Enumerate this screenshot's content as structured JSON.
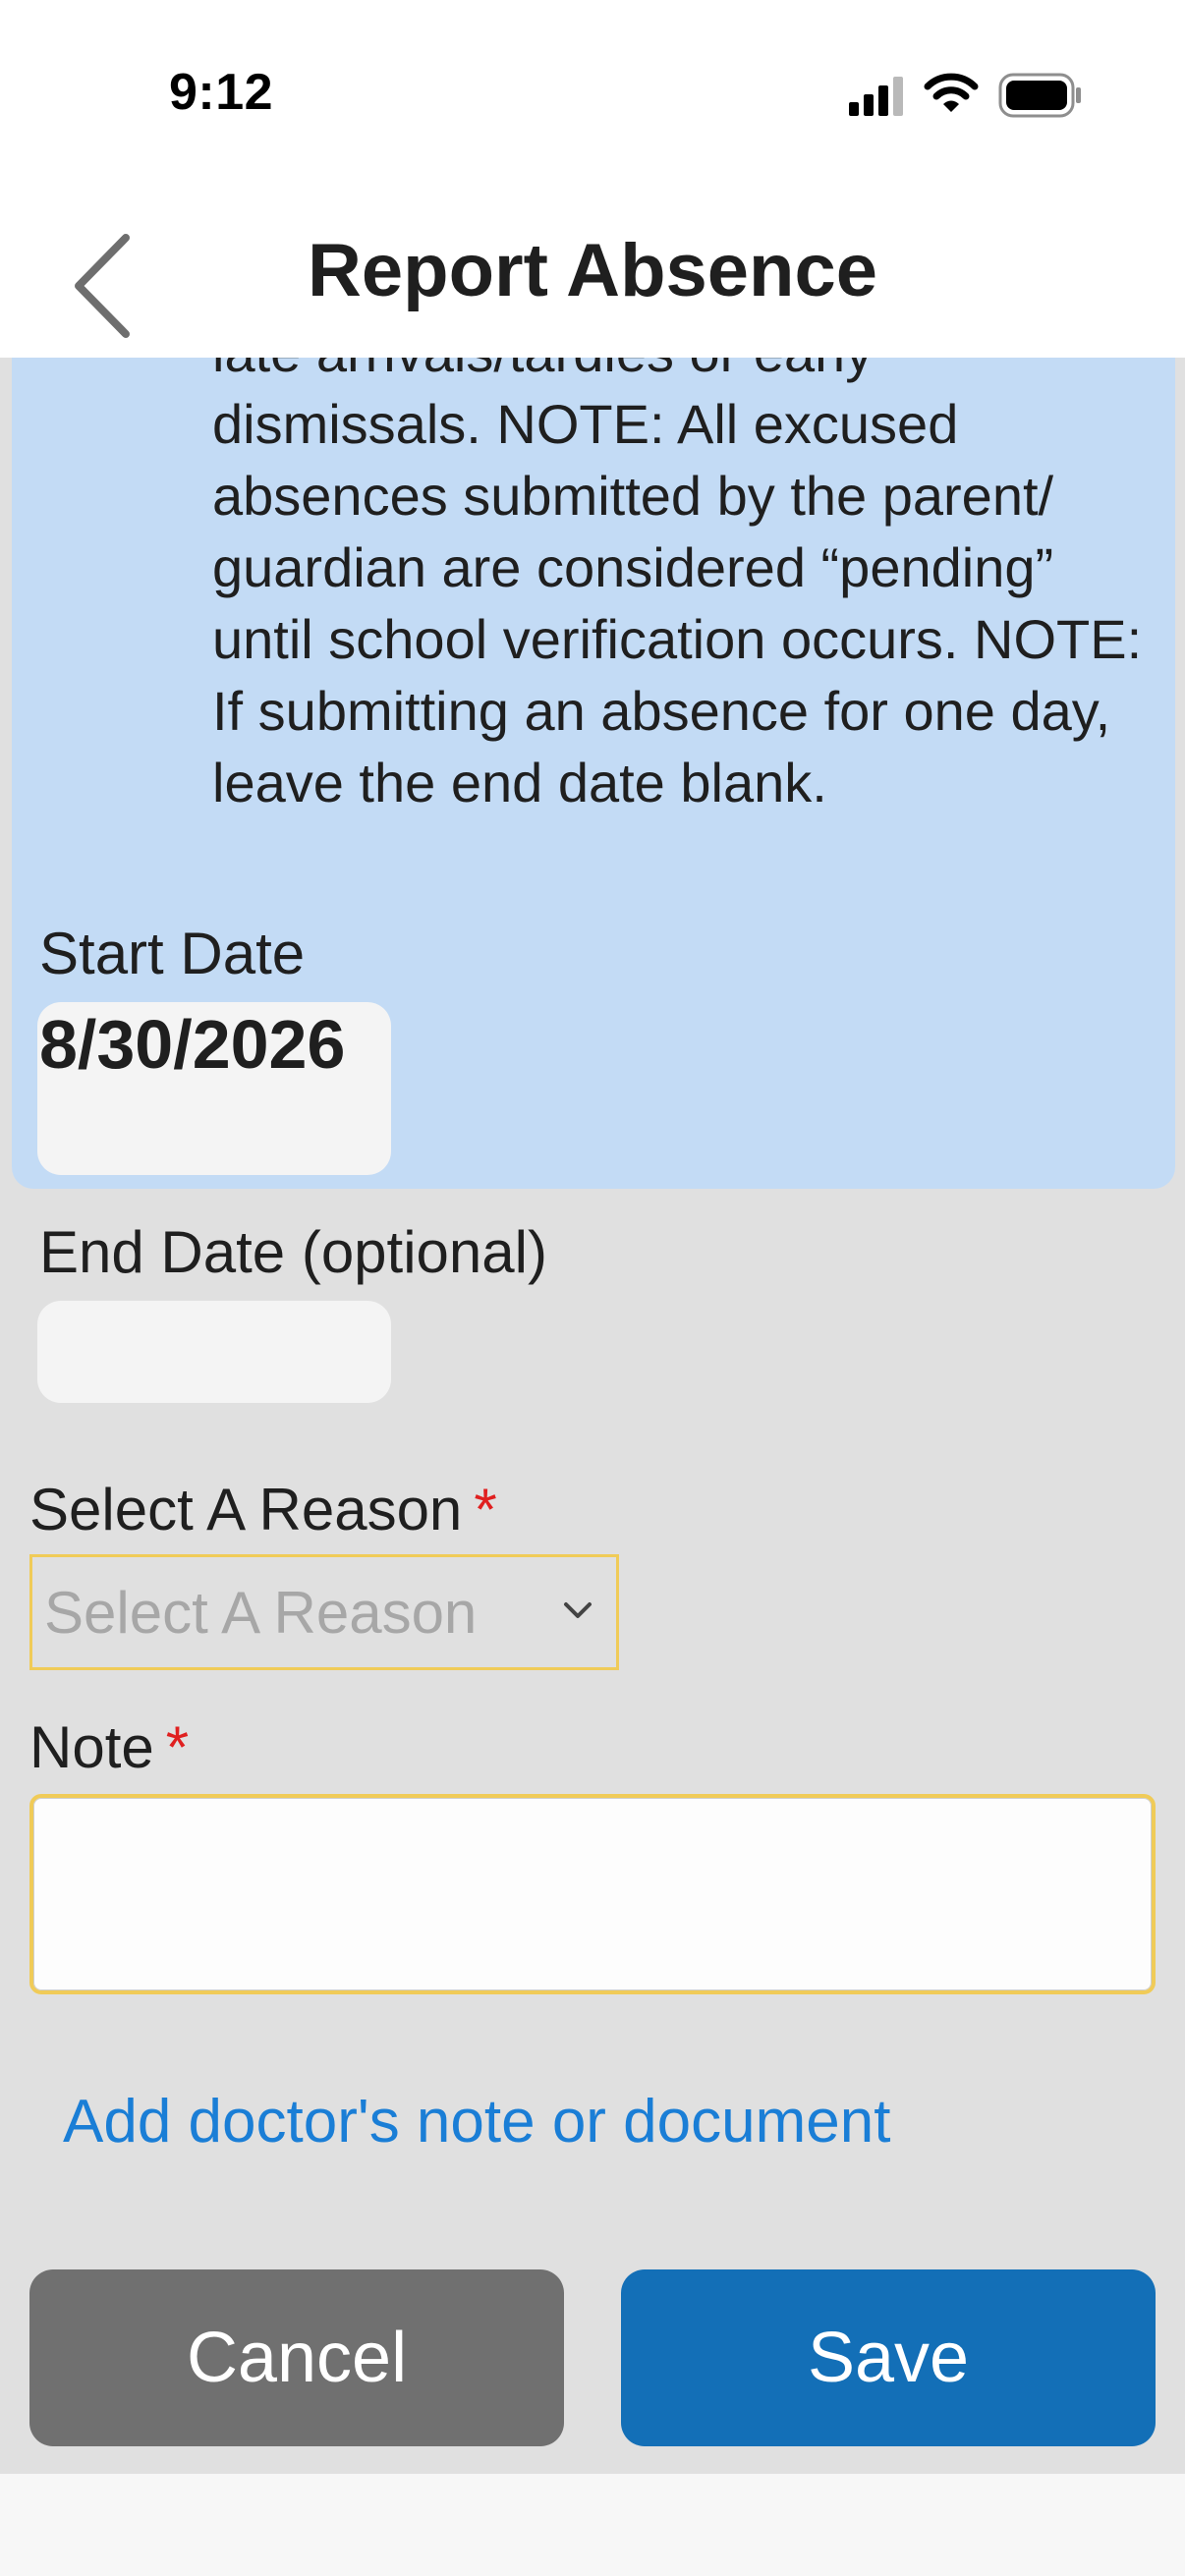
{
  "status_bar": {
    "time": "9:12",
    "icons": [
      "cellular-signal-icon",
      "wifi-icon",
      "battery-icon"
    ]
  },
  "header": {
    "title": "Report Absence",
    "back_icon": "chevron-left-icon"
  },
  "info": {
    "text": "late arrivals/tardies or early dismissals. NOTE: All excused absences submitted by the parent/ guardian are considered “pending” until school verification occurs. NOTE: If submitting an absence for one day, leave the end date blank."
  },
  "form": {
    "start_date": {
      "label": "Start Date",
      "value": "8/30/2026"
    },
    "end_date": {
      "label": "End Date (optional)",
      "value": ""
    },
    "reason": {
      "label": "Select A Reason",
      "required_mark": "*",
      "placeholder": "Select A Reason"
    },
    "note": {
      "label": "Note",
      "required_mark": "*",
      "value": ""
    },
    "add_document_link": "Add doctor's note or document"
  },
  "buttons": {
    "cancel": "Cancel",
    "save": "Save"
  },
  "colors": {
    "info_background": "#c3dbf5",
    "form_background": "#e0e0e0",
    "required": "#e02020",
    "field_highlight": "#f0cb58",
    "link": "#1a7ed6",
    "cancel_button": "#707070",
    "save_button": "#136fb7"
  }
}
